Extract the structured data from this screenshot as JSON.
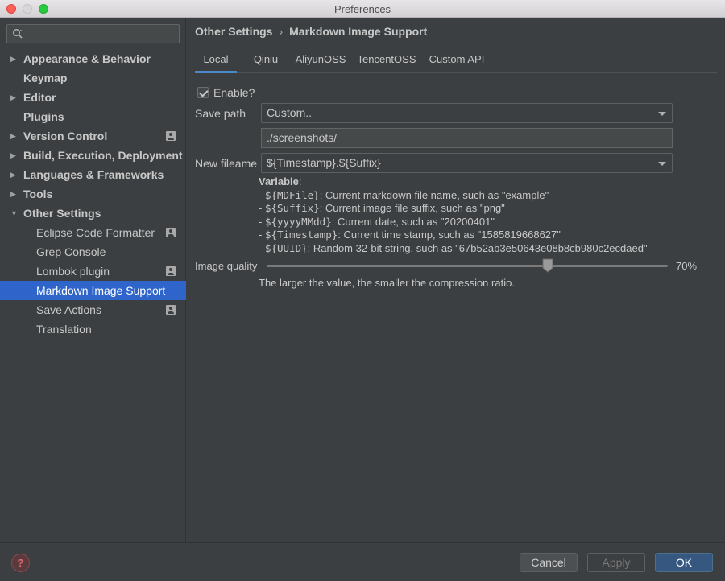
{
  "window": {
    "title": "Preferences"
  },
  "search": {
    "placeholder": ""
  },
  "sidebar": {
    "items": [
      {
        "label": "Appearance & Behavior",
        "arrow": "▶",
        "project": false
      },
      {
        "label": "Keymap",
        "arrow": "",
        "project": false
      },
      {
        "label": "Editor",
        "arrow": "▶",
        "project": false
      },
      {
        "label": "Plugins",
        "arrow": "",
        "project": false
      },
      {
        "label": "Version Control",
        "arrow": "▶",
        "project": true
      },
      {
        "label": "Build, Execution, Deployment",
        "arrow": "▶",
        "project": false
      },
      {
        "label": "Languages & Frameworks",
        "arrow": "▶",
        "project": false
      },
      {
        "label": "Tools",
        "arrow": "▶",
        "project": false
      },
      {
        "label": "Other Settings",
        "arrow": "▼",
        "project": false
      }
    ],
    "children": [
      {
        "label": "Eclipse Code Formatter",
        "project": true
      },
      {
        "label": "Grep Console",
        "project": false
      },
      {
        "label": "Lombok plugin",
        "project": true
      },
      {
        "label": "Markdown Image Support",
        "project": false,
        "selected": true
      },
      {
        "label": "Save Actions",
        "project": true
      },
      {
        "label": "Translation",
        "project": false
      }
    ]
  },
  "breadcrumb": {
    "parent": "Other Settings",
    "separator": "›",
    "current": "Markdown Image Support"
  },
  "tabs": [
    {
      "label": "Local",
      "active": true
    },
    {
      "label": "Qiniu",
      "active": false
    },
    {
      "label": "AliyunOSS",
      "active": false
    },
    {
      "label": "TencentOSS",
      "active": false
    },
    {
      "label": "Custom API",
      "active": false
    }
  ],
  "form": {
    "enable_label": "Enable?",
    "enable_checked": true,
    "save_path_label": "Save path",
    "save_path_value": "Custom..",
    "path_value": "./screenshots/",
    "filename_label": "New fileame",
    "filename_value": "${Timestamp}.${Suffix}",
    "variables": {
      "head": "Variable",
      "lines": [
        {
          "key": "${MDFile}",
          "desc": ": Current markdown file name, such as \"example\""
        },
        {
          "key": "${Suffix}",
          "desc": ": Current image file suffix, such as \"png\""
        },
        {
          "key": "${yyyyMMdd}",
          "desc": ": Current date, such as \"20200401\""
        },
        {
          "key": "${Timestamp}",
          "desc": ": Current time stamp, such as \"1585819668627\""
        },
        {
          "key": "${UUID}",
          "desc": ": Random 32-bit string, such as \"67b52ab3e50643e08b8cb980c2ecdaed\""
        }
      ]
    },
    "quality_label": "Image quality",
    "quality_value": 70,
    "quality_text": "70%",
    "quality_hint": "The larger the value, the smaller the compression ratio."
  },
  "footer": {
    "help": "?",
    "cancel": "Cancel",
    "apply": "Apply",
    "ok": "OK"
  },
  "colors": {
    "accent": "#2f65ca",
    "tab_underline": "#4a88c7",
    "ok_button": "#365880",
    "background": "#3c3f41"
  },
  "icons": {
    "search": "search-icon",
    "help": "help-icon",
    "project": "project-level-icon"
  }
}
